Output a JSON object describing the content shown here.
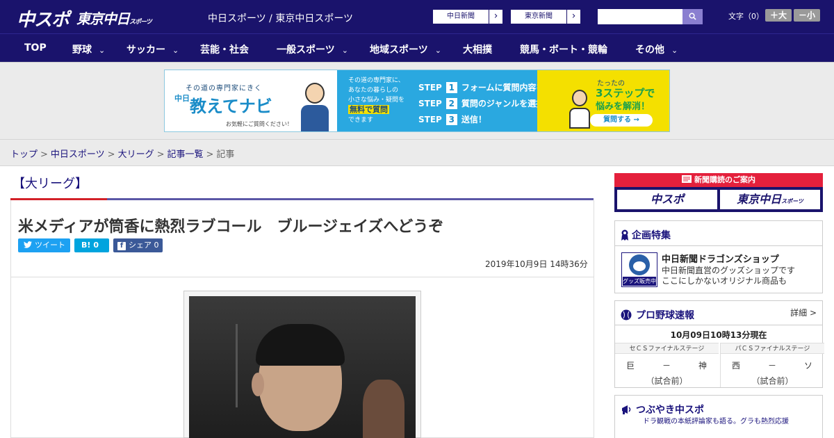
{
  "header": {
    "logo_chuspo": "中スポ",
    "logo_tokyo": "東京中日",
    "logo_tokyo_small": "スポーツ",
    "site_title": "中日スポーツ / 東京中日スポーツ",
    "paper_links": [
      {
        "label": "中日新聞",
        "arrow": "›"
      },
      {
        "label": "東京新聞",
        "arrow": "›"
      }
    ],
    "search": {
      "placeholder": "",
      "value": "",
      "icon": "magnifier"
    },
    "font_size": {
      "label": "文字（0）",
      "increase": "＋大",
      "decrease": "－小"
    }
  },
  "nav": {
    "items": [
      {
        "label": "TOP",
        "chevron": ""
      },
      {
        "label": "野球",
        "chevron": "⌄"
      },
      {
        "label": "サッカー",
        "chevron": "⌄"
      },
      {
        "label": "芸能・社会",
        "chevron": ""
      },
      {
        "label": "一般スポーツ",
        "chevron": "⌄"
      },
      {
        "label": "地域スポーツ",
        "chevron": "⌄"
      },
      {
        "label": "大相撲",
        "chevron": ""
      },
      {
        "label": "競馬・ボート・競輪",
        "chevron": ""
      },
      {
        "label": "その他",
        "chevron": "⌄"
      }
    ]
  },
  "ad": {
    "subtitle": "その道の専門家にきく",
    "brand_prefix": "中日",
    "brand": "教えてナビ",
    "small": "お気軽にご質問ください！",
    "mid_line1": "その道の専門家に、",
    "mid_line2": "あなたの暮らしの",
    "mid_line3": "小さな悩み・疑問を",
    "mid_highlight": "無料で質問",
    "mid_line4": "できます",
    "steps": [
      {
        "prefix": "STEP",
        "num": "1",
        "text": "フォームに質問内容を入力"
      },
      {
        "prefix": "STEP",
        "num": "2",
        "text": "質問のジャンルを選択"
      },
      {
        "prefix": "STEP",
        "num": "3",
        "text": "送信！"
      }
    ],
    "right_t1": "たったの",
    "right_t2": "3ステップで",
    "right_t3": "悩みを解消！",
    "right_btn": "質問する →"
  },
  "breadcrumb": {
    "items": [
      "トップ",
      "中日スポーツ",
      "大リーグ",
      "記事一覧"
    ],
    "current": "記事",
    "separator": ">"
  },
  "article": {
    "category": "【大リーグ】",
    "headline": "米メディアが筒香に熱烈ラブコール　ブルージェイズへどうぞ",
    "share": {
      "tweet": {
        "icon": "twitter-bird",
        "label": "ツイート"
      },
      "hatena": {
        "icon": "B!",
        "count": "0"
      },
      "facebook": {
        "icon": "f",
        "label": "シェア",
        "count": "0"
      }
    },
    "date": "2019年10月9日 14時36分"
  },
  "sidebar": {
    "subscription": {
      "title": "新聞購読のご案内",
      "btn1": "中スポ",
      "btn2": "東京中日",
      "btn2_small": "スポーツ"
    },
    "special": {
      "title": "企画特集",
      "thumb_label": "グッズ販売中",
      "shop_name": "中日新聞ドラゴンズショップ",
      "desc_line1": "中日新聞直営のグッズショップです",
      "desc_line2": "ここにしかないオリジナル商品も"
    },
    "baseball": {
      "title": "プロ野球速報",
      "detail": "詳細 >",
      "time": "10月09日10時13分現在",
      "games": [
        {
          "stage": "セＣＳファイナルステージ",
          "home": "巨",
          "dash": "－",
          "away": "神",
          "status": "（試合前）"
        },
        {
          "stage": "パＣＳファイナルステージ",
          "home": "西",
          "dash": "－",
          "away": "ソ",
          "status": "（試合前）"
        }
      ]
    },
    "tsubuyaki": {
      "title": "つぶやき中スポ",
      "subtitle": "ドラ観戦の本紙評論家も語る。グラも熱烈応援"
    }
  },
  "colors": {
    "brand_navy": "#1a136c",
    "accent_red": "#d32028",
    "twitter": "#1da1f2",
    "hatena": "#00a4de",
    "facebook": "#3b5998"
  }
}
